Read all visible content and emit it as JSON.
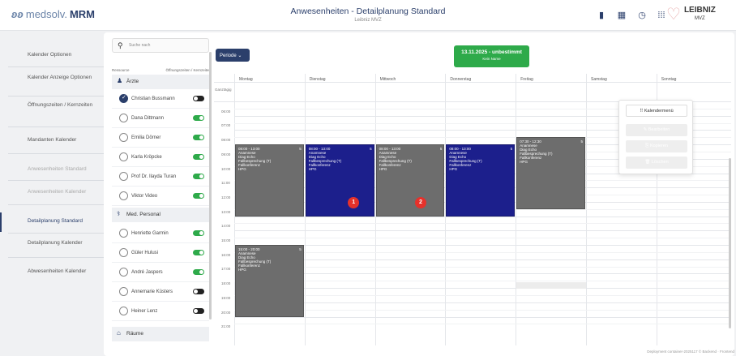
{
  "app": {
    "logo_prefix": "medsolv.",
    "logo_bold": "MRM",
    "title": "Anwesenheiten - Detailplanung Standard",
    "subtitle": "Leibniz MVZ",
    "brand": "LEIBNIZ",
    "brand_sub": "MVZ"
  },
  "toolbar_icons": [
    "document-icon",
    "calendar-icon",
    "clock-icon",
    "grid-icon",
    "help-icon",
    "avatar"
  ],
  "sidebar": [
    {
      "label": "Kalender Optionen",
      "active": false
    },
    {
      "label": "Kalender Anzeige Optionen",
      "active": false
    },
    {
      "label": "Öffnungszeiten / Kernzeiten",
      "active": false
    },
    {
      "label": "Mandanten Kalender",
      "active": false
    },
    {
      "label": "Anwesenheiten Standard",
      "active": false,
      "muted": true
    },
    {
      "label": "Anwesenheiten Kalender",
      "active": false,
      "muted": true
    },
    {
      "label": "Detailplanung Standard",
      "active": true
    },
    {
      "label": "Detailplanung Kalender",
      "active": false
    },
    {
      "label": "Abwesenheiten Kalender",
      "active": false
    }
  ],
  "resources": {
    "search_placeholder": "Suche nach",
    "col_resource": "Ressource",
    "col_hours": "Öffnungszeiten / Kernzeiten",
    "groups": [
      {
        "name": "Ärzte",
        "people": [
          {
            "name": "Christian Bussmann",
            "checked": true,
            "toggle": false
          },
          {
            "name": "Dana Dittmann",
            "checked": false,
            "toggle": true
          },
          {
            "name": "Emilia Dörner",
            "checked": false,
            "toggle": true
          },
          {
            "name": "Karla Kröpcke",
            "checked": false,
            "toggle": true
          },
          {
            "name": "Prof Dr. Ilayda Turan",
            "checked": false,
            "toggle": true
          },
          {
            "name": "Viktor Video",
            "checked": false,
            "toggle": true
          }
        ]
      },
      {
        "name": "Med. Personal",
        "people": [
          {
            "name": "Henriette Garmin",
            "checked": false,
            "toggle": true
          },
          {
            "name": "Güler Hulusi",
            "checked": false,
            "toggle": true
          },
          {
            "name": "André Jaspers",
            "checked": false,
            "toggle": true
          },
          {
            "name": "Annemarie Küsters",
            "checked": false,
            "toggle": false
          },
          {
            "name": "Heiner Lenz",
            "checked": false,
            "toggle": false
          }
        ]
      },
      {
        "name": "Räume",
        "people": []
      }
    ]
  },
  "calendar": {
    "period_button": "Periode ⌄",
    "date_range": "13.11.2025 - unbestimmt",
    "date_sub": "Kein Name",
    "allday": "Ganztägig",
    "days": [
      "Montag",
      "Dienstag",
      "Mittwoch",
      "Donnerstag",
      "Freitag",
      "Samstag",
      "Sonntag"
    ],
    "times": [
      "06:00",
      "07:00",
      "08:00",
      "09:00",
      "10:00",
      "11:00",
      "12:00",
      "13:00",
      "14:00",
      "15:00",
      "16:00",
      "17:00",
      "18:00",
      "19:00",
      "20:00",
      "21:00"
    ],
    "events": [
      {
        "day": 0,
        "start": 8,
        "end": 13,
        "label": "08:00 - 13:00",
        "lines": [
          "Anamnese",
          "Diag Echo",
          "Fallbesprechung (T)",
          "Fallkonferenz",
          "HPG"
        ],
        "count": "5",
        "color": "gray"
      },
      {
        "day": 1,
        "start": 8,
        "end": 13,
        "label": "08:00 - 13:00",
        "lines": [
          "Anamnese",
          "Diag Echo",
          "Fallbesprechung (T)",
          "Fallkonferenz",
          "HPG"
        ],
        "count": "5",
        "color": "blue",
        "badge": "1"
      },
      {
        "day": 2,
        "start": 8,
        "end": 13,
        "label": "08:00 - 13:00",
        "lines": [
          "Anamnese",
          "Diag Echo",
          "Fallbesprechung (T)",
          "Fallkonferenz",
          "HPG"
        ],
        "count": "5",
        "color": "gray",
        "badge": "2"
      },
      {
        "day": 3,
        "start": 8,
        "end": 13,
        "label": "08:00 - 13:00",
        "lines": [
          "Anamnese",
          "Diag Echo",
          "Fallbesprechung (T)",
          "Fallkonferenz",
          "HPG"
        ],
        "count": "5",
        "color": "blue"
      },
      {
        "day": 4,
        "start": 7.5,
        "end": 12.5,
        "label": "07:30 - 12:30",
        "lines": [
          "Anamnese",
          "Diag Echo",
          "Fallbesprechung (T)",
          "Fallkonferenz",
          "HPG"
        ],
        "count": "5",
        "color": "gray"
      },
      {
        "day": 0,
        "start": 15,
        "end": 20,
        "label": "15:00 - 20:00",
        "lines": [
          "Anamnese",
          "Diag Echo",
          "Fallbesprechung (T)",
          "Fallkonferenz",
          "HPG"
        ],
        "count": "5",
        "color": "gray"
      }
    ]
  },
  "popup": {
    "title": "⠿  Kalendermenü",
    "edit": "✎  Bearbeiten",
    "copy": "⎘  Kopieren",
    "delete": "🗑  Löschen"
  },
  "footer": "Deployment container-2025117 ©  Backend  ·  Frontend"
}
